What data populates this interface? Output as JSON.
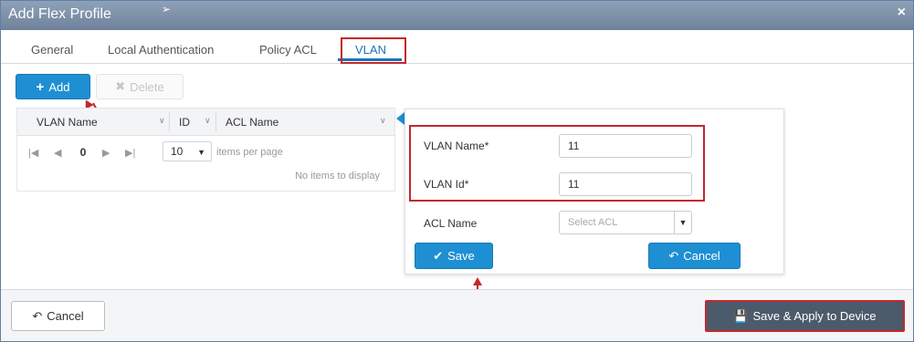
{
  "window": {
    "title": "Add Flex Profile",
    "close_glyph": "×"
  },
  "tabs": [
    {
      "label": "General"
    },
    {
      "label": "Local Authentication"
    },
    {
      "label": "Policy ACL"
    },
    {
      "label": "VLAN",
      "active": true
    }
  ],
  "toolbar": {
    "add_label": "Add",
    "delete_label": "Delete"
  },
  "grid": {
    "columns": [
      "VLAN Name",
      "ID",
      "ACL Name"
    ],
    "pager": {
      "page": "0",
      "per_page": "10",
      "per_page_label": "items per page"
    },
    "empty_text": "No items to display"
  },
  "form": {
    "vlan_name": {
      "label": "VLAN Name*",
      "value": "11"
    },
    "vlan_id": {
      "label": "VLAN Id*",
      "value": "11"
    },
    "acl_name": {
      "label": "ACL Name",
      "placeholder": "Select ACL"
    },
    "save_label": "Save",
    "cancel_label": "Cancel"
  },
  "footer": {
    "cancel_label": "Cancel",
    "save_apply_label": "Save & Apply to Device"
  },
  "colors": {
    "accent": "#1e8fd2",
    "highlight": "#c4282d",
    "titlebar": "#7d90a8",
    "dark_button": "#4b5b6c"
  },
  "icons": [
    "plus-icon",
    "x-icon",
    "first-page-icon",
    "prev-page-icon",
    "next-page-icon",
    "last-page-icon",
    "check-icon",
    "undo-icon",
    "save-disk-icon",
    "close-icon"
  ]
}
